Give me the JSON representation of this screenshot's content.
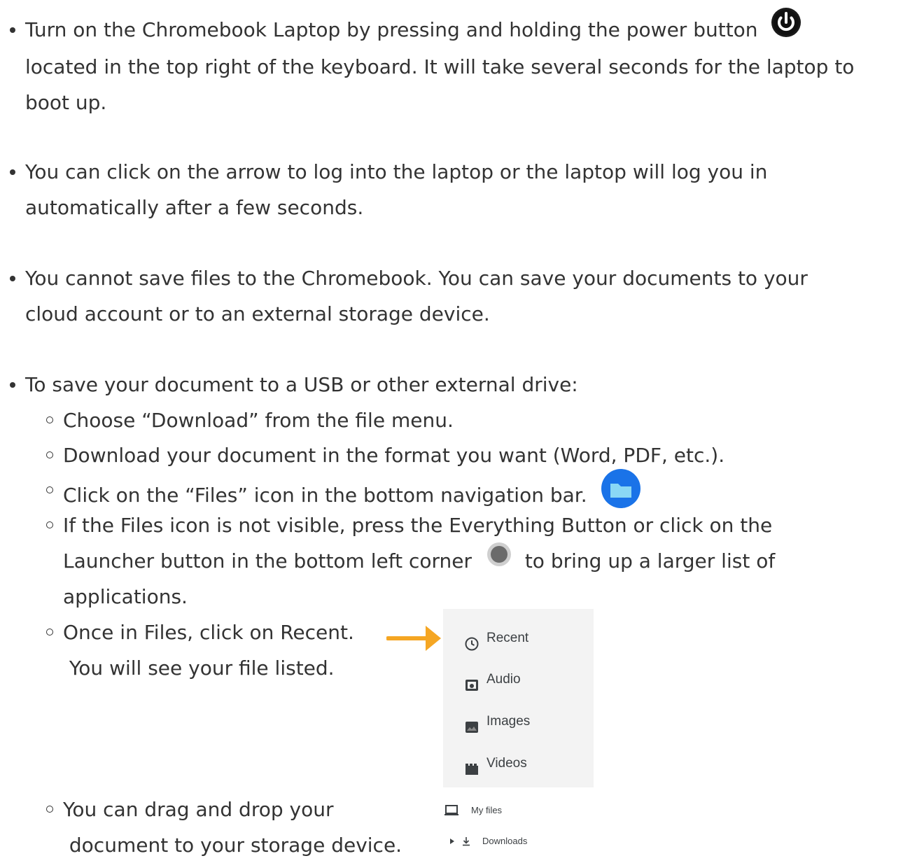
{
  "bullets": [
    {
      "lines": [
        "Turn on the Chromebook Laptop by pressing and holding the power button",
        " located in the top right of the keyboard. It will take several seconds for the laptop to",
        "boot up."
      ]
    },
    {
      "lines": [
        "You can click on the arrow to log into the laptop or the laptop will log you in",
        "automatically after a few seconds."
      ]
    },
    {
      "lines": [
        "You cannot save files to the Chromebook. You can save your documents to your",
        "cloud account or to an external storage device."
      ]
    },
    {
      "lines": [
        "To save your document to a USB or other external drive:"
      ]
    }
  ],
  "subitems": [
    {
      "lines": [
        "Choose “Download” from the file menu."
      ]
    },
    {
      "lines": [
        "Download your document in the format you want (Word, PDF, etc.)."
      ]
    },
    {
      "lines": [
        "Click on the “Files” icon in the bottom navigation bar."
      ]
    },
    {
      "lines": [
        "If the Files icon is not visible, press the Everything Button or click on the",
        "Launcher button in the bottom left corner",
        "applications."
      ],
      "trailing": " to bring up a larger list of"
    },
    {
      "lines": [
        "Once in Files, click on Recent.",
        " You will see your file listed."
      ]
    },
    {
      "lines": [
        "You can drag and drop your",
        " document to your storage device."
      ]
    }
  ],
  "files_panel": {
    "items": [
      {
        "label": "Recent",
        "icon": "clock-icon"
      },
      {
        "label": "Audio",
        "icon": "audio-folder-icon"
      },
      {
        "label": "Images",
        "icon": "image-icon"
      },
      {
        "label": "Videos",
        "icon": "video-icon"
      }
    ],
    "tree": [
      {
        "label": "My files",
        "icon": "laptop-icon"
      },
      {
        "label": "Downloads",
        "icon": "download-icon"
      }
    ]
  },
  "colors": {
    "text": "#333333",
    "arrow": "#f5a623",
    "files_icon": "#1a73e8",
    "files_icon_inner": "#8ad8f5"
  }
}
